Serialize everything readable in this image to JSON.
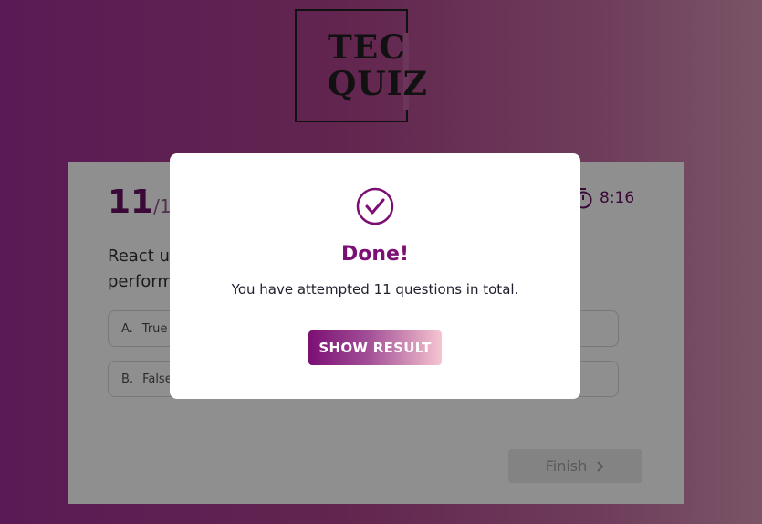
{
  "logo": {
    "line1": "TEC",
    "line2": "QUIZ"
  },
  "quiz": {
    "current": "11",
    "total": "/11",
    "timer": "8:16",
    "question": "React u... perform...",
    "question_line1": "React u",
    "question_line2": "perform",
    "options": [
      {
        "letter": "A.",
        "label": "True"
      },
      {
        "letter": "B.",
        "label": "False"
      }
    ],
    "finish_label": "Finish"
  },
  "modal": {
    "title": "Done!",
    "message": "You have attempted 11 questions in total.",
    "button_label": "SHOW RESULT"
  },
  "colors": {
    "accent": "#7b0f73",
    "button_gradient_end": "#f6c4cf",
    "background_left": "#5a1a55",
    "background_right": "#7a5566"
  },
  "icons": [
    "check-circle-icon",
    "stopwatch-icon",
    "chevron-right-icon"
  ]
}
